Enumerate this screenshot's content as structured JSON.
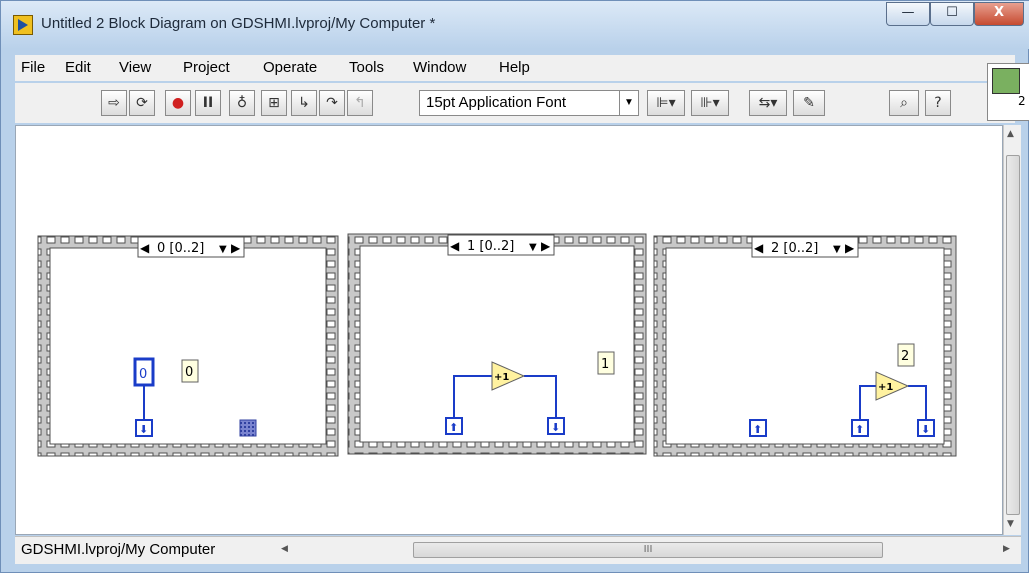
{
  "window": {
    "title": "Untitled 2 Block Diagram on GDSHMI.lvproj/My Computer *",
    "controls": {
      "minimize": "—",
      "maximize": "☐",
      "close": "X"
    }
  },
  "menu": {
    "items": [
      "File",
      "Edit",
      "View",
      "Project",
      "Operate",
      "Tools",
      "Window",
      "Help"
    ]
  },
  "toolbar": {
    "font_select": "15pt Application Font",
    "buttons": [
      "run-arrow-icon",
      "run-continuous-icon",
      "abort-icon",
      "pause-icon",
      "highlight-execution-icon",
      "retain-wire-values-icon",
      "step-into-icon",
      "step-over-icon",
      "step-out-icon",
      "align-icon",
      "distribute-icon",
      "reorder-icon",
      "cleanup-diagram-icon",
      "search-icon",
      "help-icon"
    ]
  },
  "palette": {
    "number": "2"
  },
  "diagram": {
    "frames": [
      {
        "selector": "0 [0..2]",
        "constants": [
          "0",
          "0"
        ]
      },
      {
        "selector": "1 [0..2]",
        "constants": [
          "1"
        ],
        "increment_label": "+1"
      },
      {
        "selector": "2 [0..2]",
        "constants": [
          "2"
        ],
        "increment_label": "+1"
      }
    ]
  },
  "statusbar": {
    "context": "GDSHMI.lvproj/My Computer",
    "scroll_grip": "III"
  },
  "colors": {
    "titlebar": "#b9d1ea",
    "frame_border": "#6e6e6e",
    "wire_blue": "#1a3cc8",
    "constant_fill": "#ffffe0",
    "increment_fill": "#fff2a0"
  }
}
